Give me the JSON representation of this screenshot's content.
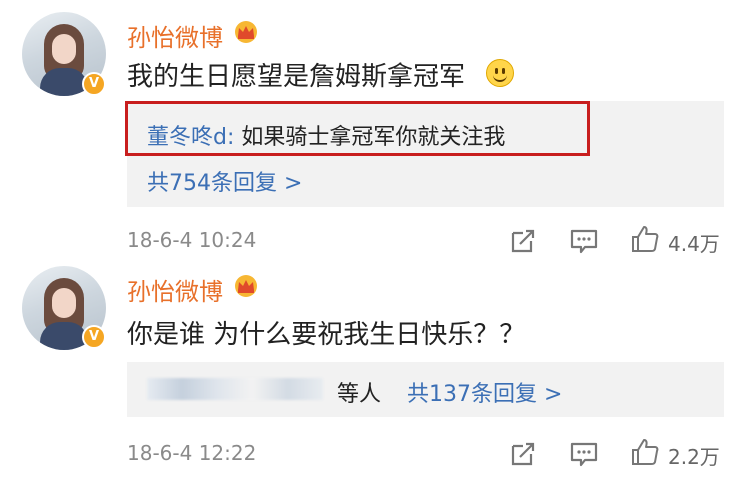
{
  "comments": [
    {
      "username": "孙怡微博",
      "verified_icon": "vip-crown-icon",
      "text": "我的生日愿望是詹姆斯拿冠军",
      "emoji": "smile-emoji-icon",
      "reply_author": "董冬咚d:",
      "reply_text": " 如果骑士拿冠军你就关注我",
      "reply_more": "共754条回复 >",
      "time": "18-6-4 10:24",
      "likes": "4.4万"
    },
    {
      "username": "孙怡微博",
      "verified_icon": "vip-crown-icon",
      "text": "你是谁 为什么要祝我生日快乐？？",
      "reply_suffix": "等人",
      "reply_more": "共137条回复 >",
      "time": "18-6-4 12:22",
      "likes": "2.2万"
    }
  ],
  "colors": {
    "username": "#e8702a",
    "link": "#3b6fb5",
    "highlight": "#c81e1e",
    "reply_bg": "#f2f2f2"
  }
}
